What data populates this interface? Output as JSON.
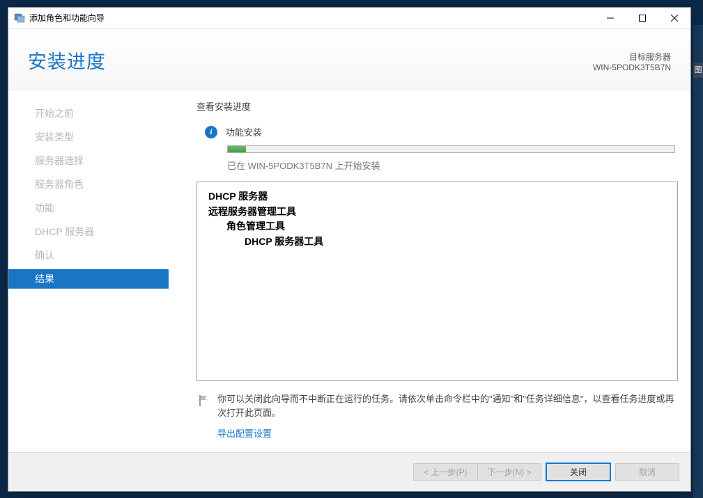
{
  "bg_tab": "图",
  "titlebar": {
    "title": "添加角色和功能向导"
  },
  "header": {
    "title": "安装进度"
  },
  "target": {
    "label": "目标服务器",
    "name": "WIN-5PODK3T5B7N"
  },
  "sidebar": {
    "items": [
      {
        "label": "开始之前",
        "active": false
      },
      {
        "label": "安装类型",
        "active": false
      },
      {
        "label": "服务器选择",
        "active": false
      },
      {
        "label": "服务器角色",
        "active": false
      },
      {
        "label": "功能",
        "active": false
      },
      {
        "label": "DHCP 服务器",
        "active": false
      },
      {
        "label": "确认",
        "active": false
      },
      {
        "label": "结果",
        "active": true
      }
    ]
  },
  "main": {
    "progress_label": "查看安装进度",
    "status_text": "功能安装",
    "status_detail": "已在 WIN-5PODK3T5B7N 上开始安装",
    "features": [
      {
        "text": "DHCP 服务器",
        "indent": 1
      },
      {
        "text": "远程服务器管理工具",
        "indent": 1
      },
      {
        "text": "角色管理工具",
        "indent": 2
      },
      {
        "text": "DHCP 服务器工具",
        "indent": 3
      }
    ],
    "note_text": "你可以关闭此向导而不中断正在运行的任务。请依次单击命令栏中的\"通知\"和\"任务详细信息\"，以查看任务进度或再次打开此页面。",
    "export_link": "导出配置设置"
  },
  "footer": {
    "prev": "< 上一步(P)",
    "next": "下一步(N) >",
    "close": "关闭",
    "cancel": "取消"
  }
}
